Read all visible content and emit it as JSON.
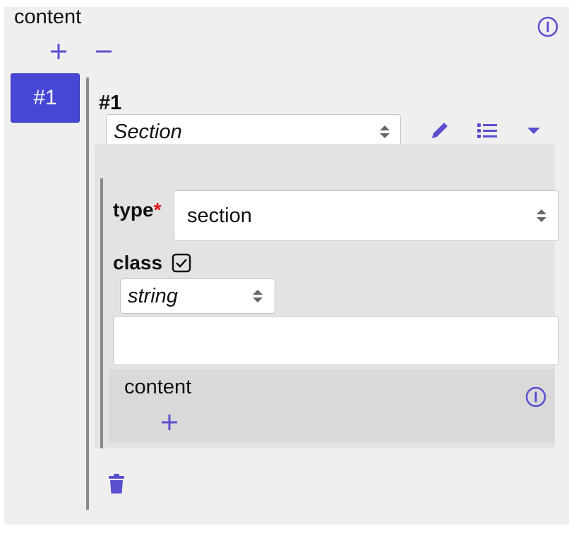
{
  "header": {
    "title": "content",
    "info_icon": "info-icon",
    "add_icon": "plus-icon",
    "remove_icon": "minus-icon"
  },
  "tabs": [
    {
      "label": "#1",
      "active": true
    }
  ],
  "item": {
    "label": "#1",
    "schema_select": {
      "value": "Section"
    },
    "toolbar": {
      "edit_icon": "pencil-icon",
      "list_icon": "list-icon",
      "collapse_icon": "caret-down-icon"
    },
    "properties": {
      "type": {
        "label": "type",
        "required_mark": "*",
        "value": "section"
      },
      "class": {
        "label": "class",
        "checked": true,
        "type_select": {
          "value": "string"
        },
        "input_value": ""
      },
      "content": {
        "title": "content",
        "info_icon": "info-icon",
        "add_icon": "plus-icon"
      }
    },
    "delete_icon": "trash-icon"
  },
  "colors": {
    "accent": "#4747d6",
    "icon": "#5a4fcf",
    "required": "#e0161a",
    "panel_bg": "#efefef",
    "section_bg": "#e3e3e3",
    "content_bg": "#d9d9d9"
  }
}
